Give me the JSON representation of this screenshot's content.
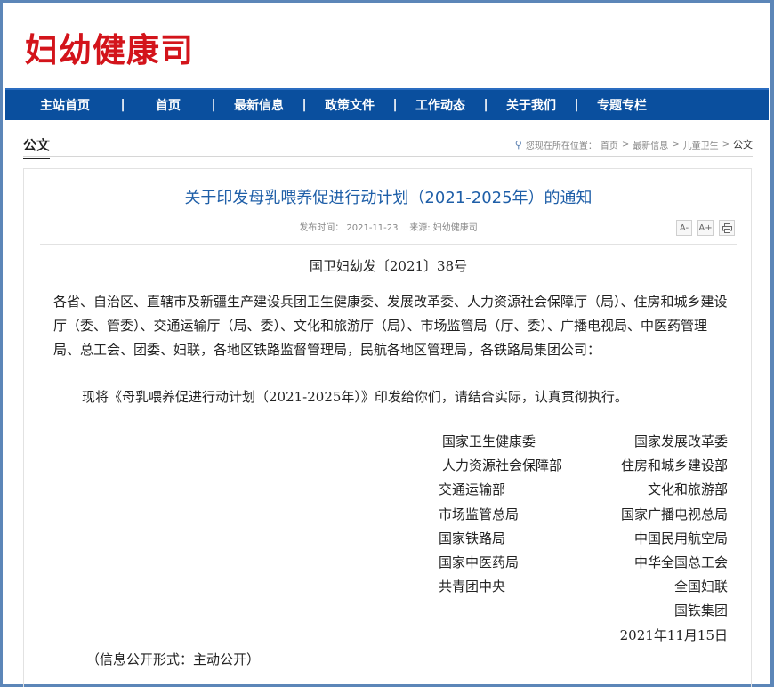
{
  "header": {
    "logo_text": "妇幼健康司"
  },
  "nav": {
    "items": [
      "主站首页",
      "首页",
      "最新信息",
      "政策文件",
      "工作动态",
      "关于我们",
      "专题专栏"
    ],
    "separator": "|"
  },
  "breadcrumb": {
    "section_title": "公文",
    "location_label": "您现在所在位置：",
    "items": [
      "首页",
      "最新信息",
      "儿童卫生"
    ],
    "current": "公文",
    "sep": ">"
  },
  "article": {
    "title": "关于印发母乳喂养促进行动计划（2021-2025年）的通知",
    "publish_label": "发布时间：",
    "publish_date": "2021-11-23",
    "source_label": "来源:",
    "source": "妇幼健康司",
    "tools": {
      "font_small": "A-",
      "font_large": "A+",
      "print_icon": "print-icon"
    },
    "doc_number": "国卫妇幼发〔2021〕38号",
    "recipients": "各省、自治区、直辖市及新疆生产建设兵团卫生健康委、发展改革委、人力资源社会保障厅（局）、住房和城乡建设厅（委、管委）、交通运输厅（局、委）、文化和旅游厅（局）、市场监管局（厅、委）、广播电视局、中医药管理局、总工会、团委、妇联，各地区铁路监督管理局，民航各地区管理局，各铁路局集团公司：",
    "body": "现将《母乳喂养促进行动计划（2021-2025年）》印发给你们，请结合实际，认真贯彻执行。",
    "signers": [
      {
        "left": "国家卫生健康委",
        "right": "国家发展改革委"
      },
      {
        "left": "人力资源社会保障部",
        "right": "住房和城乡建设部"
      },
      {
        "left": "交通运输部",
        "right": "文化和旅游部"
      },
      {
        "left": "市场监管总局",
        "right": "国家广播电视总局"
      },
      {
        "left": "国家铁路局",
        "right": "中国民用航空局"
      },
      {
        "left": "国家中医药局",
        "right": "中华全国总工会"
      },
      {
        "left": "共青团中央",
        "right": "全国妇联"
      },
      {
        "left": "",
        "right": "国铁集团"
      },
      {
        "left": "",
        "right": "2021年11月15日"
      }
    ],
    "disclosure": "（信息公开形式：主动公开）"
  },
  "colors": {
    "logo": "#d3141b",
    "nav_bg": "#0a4f9e",
    "title": "#1f5fa8",
    "frame": "#5c86b8"
  }
}
